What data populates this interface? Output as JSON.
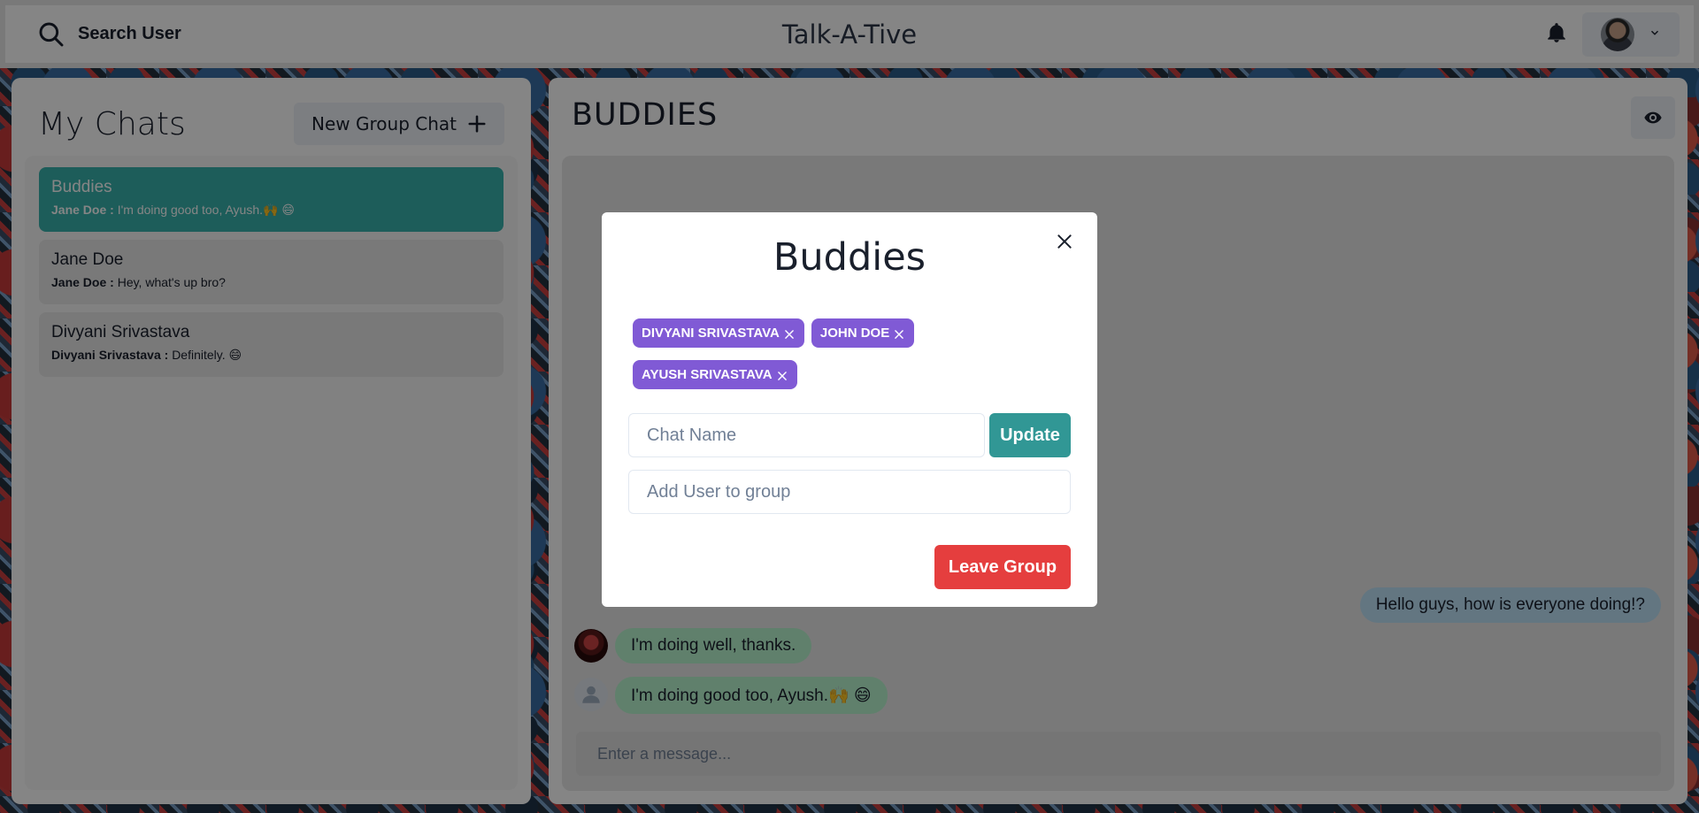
{
  "header": {
    "search_label": "Search User",
    "app_title": "Talk-A-Tive"
  },
  "sidebar": {
    "title": "My Chats",
    "new_group_label": "New Group Chat",
    "chats": [
      {
        "name": "Buddies",
        "sender": "Jane Doe :",
        "message": "I'm doing good too, Ayush.🙌 😄",
        "active": true
      },
      {
        "name": "Jane Doe",
        "sender": "Jane Doe :",
        "message": "Hey, what's up bro?",
        "active": false
      },
      {
        "name": "Divyani Srivastava",
        "sender": "Divyani Srivastava :",
        "message": "Definitely. 😄",
        "active": false
      }
    ]
  },
  "chat": {
    "title": "BUDDIES",
    "messages": [
      {
        "text": "Hello guys, how is everyone doing!?",
        "mine": true
      },
      {
        "text": "I'm doing well, thanks.",
        "mine": false
      },
      {
        "text": "I'm doing good too, Ayush.🙌 😄",
        "mine": false
      }
    ],
    "input_placeholder": "Enter a message..."
  },
  "modal": {
    "title": "Buddies",
    "members": [
      "DIVYANI SRIVASTAVA",
      "JOHN DOE",
      "AYUSH SRIVASTAVA"
    ],
    "chat_name_placeholder": "Chat Name",
    "update_label": "Update",
    "add_user_placeholder": "Add User to group",
    "leave_label": "Leave Group"
  },
  "colors": {
    "active_chat": "#38b2ac",
    "badge": "#805ad5",
    "update_button": "#319795",
    "leave_button": "#e53e3e",
    "my_message": "#bee3f8",
    "their_message": "#b9f5d0"
  }
}
